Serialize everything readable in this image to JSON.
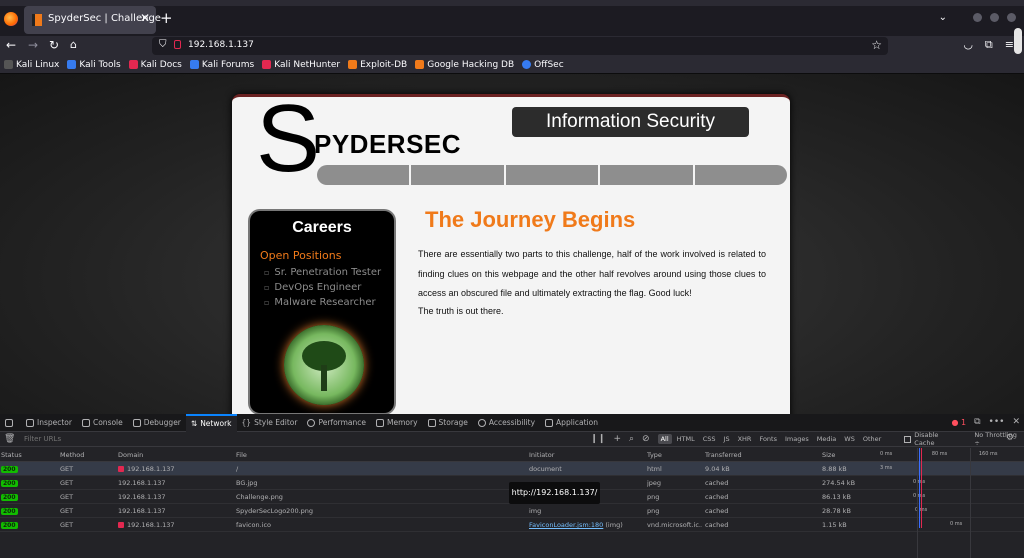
{
  "browser": {
    "tab_title": "SpyderSec | Challenge",
    "url": "192.168.1.137",
    "bookmarks": [
      "Kali Linux",
      "Kali Tools",
      "Kali Docs",
      "Kali Forums",
      "Kali NetHunter",
      "Exploit-DB",
      "Google Hacking DB",
      "OffSec"
    ]
  },
  "page": {
    "logo_s": "S",
    "logo_rest": "PYDERSEC",
    "tagline": "Information Security",
    "careers": {
      "heading": "Careers",
      "open_positions": "Open Positions",
      "positions": [
        "Sr. Penetration Tester",
        "DevOps Engineer",
        "Malware Researcher"
      ]
    },
    "heading": "The Journey Begins",
    "body": "There are essentially two parts to this challenge, half of the work involved is related to finding clues on this webpage and the other half revolves around using those clues to access an obscured file and ultimately extracting the flag. Good luck!",
    "truth": "The truth is out there."
  },
  "devtools": {
    "tabs": [
      "Inspector",
      "Console",
      "Debugger",
      "Network",
      "Style Editor",
      "Performance",
      "Memory",
      "Storage",
      "Accessibility",
      "Application"
    ],
    "active_tab": "Network",
    "error_count": "1",
    "filter_placeholder": "Filter URLs",
    "types": [
      "All",
      "HTML",
      "CSS",
      "JS",
      "XHR",
      "Fonts",
      "Images",
      "Media",
      "WS",
      "Other"
    ],
    "disable_cache": "Disable Cache",
    "throttling": "No Throttling ÷",
    "columns": [
      "Status",
      "Method",
      "Domain",
      "File",
      "Initiator",
      "Type",
      "Transferred",
      "Size"
    ],
    "waterfall_ticks": [
      "0 ms",
      "80 ms",
      "160 ms"
    ],
    "requests": [
      {
        "status": "200",
        "method": "GET",
        "domain": "192.168.1.137",
        "file": "/",
        "initiator": "document",
        "type": "html",
        "transferred": "9.04 kB",
        "size": "8.88 kB",
        "wf": "3 ms"
      },
      {
        "status": "200",
        "method": "GET",
        "domain": "192.168.1.137",
        "file": "BG.jpg",
        "initiator": "",
        "type": "jpeg",
        "transferred": "cached",
        "size": "274.54 kB",
        "wf": "0 ms"
      },
      {
        "status": "200",
        "method": "GET",
        "domain": "192.168.1.137",
        "file": "Challenge.png",
        "initiator": "",
        "type": "png",
        "transferred": "cached",
        "size": "86.13 kB",
        "wf": "0 ms"
      },
      {
        "status": "200",
        "method": "GET",
        "domain": "192.168.1.137",
        "file": "SpyderSecLogo200.png",
        "initiator": "img",
        "type": "png",
        "transferred": "cached",
        "size": "28.78 kB",
        "wf": "0 ms"
      },
      {
        "status": "200",
        "method": "GET",
        "domain": "192.168.1.137",
        "file": "favicon.ico",
        "initiator": "FaviconLoader.jsm:180",
        "initiator_suffix": "(img)",
        "type": "vnd.microsoft.ic...",
        "transferred": "cached",
        "size": "1.15 kB",
        "wf": "0 ms"
      }
    ],
    "tooltip": "http://192.168.1.137/"
  }
}
